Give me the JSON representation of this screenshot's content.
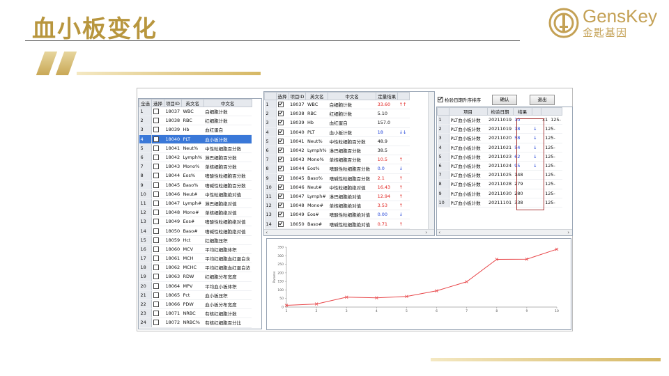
{
  "slide": {
    "title": "血小板变化",
    "logo_en": "GensKey",
    "logo_cn": "金匙基因"
  },
  "left_table": {
    "headers": [
      "全选",
      "选择",
      "项目ID",
      "英文名",
      "中文名"
    ],
    "rows": [
      {
        "n": "1",
        "id": "18037",
        "en": "WBC",
        "cn": "白细胞计数",
        "checked": false
      },
      {
        "n": "2",
        "id": "18038",
        "en": "RBC",
        "cn": "红细胞计数",
        "checked": false
      },
      {
        "n": "3",
        "id": "18039",
        "en": "Hb",
        "cn": "血红蛋白",
        "checked": false
      },
      {
        "n": "4",
        "id": "18040",
        "en": "PLT",
        "cn": "血小板计数",
        "checked": false,
        "selected": true
      },
      {
        "n": "5",
        "id": "18041",
        "en": "Neut%",
        "cn": "中性粒细胞百分数",
        "checked": false
      },
      {
        "n": "6",
        "id": "18042",
        "en": "Lymph%",
        "cn": "淋巴细胞百分数",
        "checked": false
      },
      {
        "n": "7",
        "id": "18043",
        "en": "Mono%",
        "cn": "单核细胞百分数",
        "checked": false
      },
      {
        "n": "8",
        "id": "18044",
        "en": "Eos%",
        "cn": "嗜酸性粒细胞百分数",
        "checked": false
      },
      {
        "n": "9",
        "id": "18045",
        "en": "Baso%",
        "cn": "嗜碱性粒细胞百分数",
        "checked": false
      },
      {
        "n": "10",
        "id": "18046",
        "en": "Neut#",
        "cn": "中性粒细胞绝对值",
        "checked": false
      },
      {
        "n": "11",
        "id": "18047",
        "en": "Lymph#",
        "cn": "淋巴细胞绝对值",
        "checked": false
      },
      {
        "n": "12",
        "id": "18048",
        "en": "Mono#",
        "cn": "单核细胞绝对值",
        "checked": false
      },
      {
        "n": "13",
        "id": "18049",
        "en": "Eos#",
        "cn": "嗜酸性粒细胞绝对值",
        "checked": false
      },
      {
        "n": "14",
        "id": "18050",
        "en": "Baso#",
        "cn": "嗜碱性粒细胞绝对值",
        "checked": false
      },
      {
        "n": "15",
        "id": "18059",
        "en": "Hct",
        "cn": "红细胞压积",
        "checked": false
      },
      {
        "n": "16",
        "id": "18060",
        "en": "MCV",
        "cn": "平均红细胞体积",
        "checked": false
      },
      {
        "n": "17",
        "id": "18061",
        "en": "MCH",
        "cn": "平均红细胞血红蛋白含",
        "checked": false
      },
      {
        "n": "18",
        "id": "18062",
        "en": "MCHC",
        "cn": "平均红细胞血红蛋白浓",
        "checked": false
      },
      {
        "n": "19",
        "id": "18063",
        "en": "RDW",
        "cn": "红细胞分布宽度",
        "checked": false
      },
      {
        "n": "20",
        "id": "18064",
        "en": "MPV",
        "cn": "平均血小板体积",
        "checked": false
      },
      {
        "n": "21",
        "id": "18065",
        "en": "Pct",
        "cn": "血小板压积",
        "checked": false
      },
      {
        "n": "22",
        "id": "18066",
        "en": "PDW",
        "cn": "血小板分布宽度",
        "checked": false
      },
      {
        "n": "23",
        "id": "18071",
        "en": "NRBC",
        "cn": "有核红细胞计数",
        "checked": false
      },
      {
        "n": "24",
        "id": "18072",
        "en": "NRBC%",
        "cn": "有核红细胞百分比",
        "checked": false
      }
    ]
  },
  "mid_table": {
    "headers": [
      "选择",
      "项目ID",
      "英文名",
      "中文名",
      "定量结果",
      ""
    ],
    "rows": [
      {
        "n": "1",
        "id": "18037",
        "en": "WBC",
        "cn": "白细胞计数",
        "val": "33.60",
        "flag": "↑↑",
        "color": "red"
      },
      {
        "n": "2",
        "id": "18038",
        "en": "RBC",
        "cn": "红细胞计数",
        "val": "5.10",
        "flag": "",
        "color": ""
      },
      {
        "n": "3",
        "id": "18039",
        "en": "Hb",
        "cn": "血红蛋白",
        "val": "157.0",
        "flag": "",
        "color": ""
      },
      {
        "n": "4",
        "id": "18040",
        "en": "PLT",
        "cn": "血小板计数",
        "val": "18",
        "flag": "↓↓",
        "color": "blue"
      },
      {
        "n": "5",
        "id": "18041",
        "en": "Neut%",
        "cn": "中性粒细胞百分数",
        "val": "48.9",
        "flag": "",
        "color": ""
      },
      {
        "n": "6",
        "id": "18042",
        "en": "Lymph%",
        "cn": "淋巴细胞百分数",
        "val": "38.5",
        "flag": "",
        "color": ""
      },
      {
        "n": "7",
        "id": "18043",
        "en": "Mono%",
        "cn": "单核细胞百分数",
        "val": "10.5",
        "flag": "↑",
        "color": "red"
      },
      {
        "n": "8",
        "id": "18044",
        "en": "Eos%",
        "cn": "嗜酸性粒细胞百分数",
        "val": "0.0",
        "flag": "↓",
        "color": "blue"
      },
      {
        "n": "9",
        "id": "18045",
        "en": "Baso%",
        "cn": "嗜碱性粒细胞百分数",
        "val": "2.1",
        "flag": "↑",
        "color": "red"
      },
      {
        "n": "10",
        "id": "18046",
        "en": "Neut#",
        "cn": "中性粒细胞绝对值",
        "val": "16.43",
        "flag": "↑",
        "color": "red"
      },
      {
        "n": "11",
        "id": "18047",
        "en": "Lymph#",
        "cn": "淋巴细胞绝对值",
        "val": "12.94",
        "flag": "↑",
        "color": "red"
      },
      {
        "n": "12",
        "id": "18048",
        "en": "Mono#",
        "cn": "单核细胞绝对值",
        "val": "3.53",
        "flag": "↑",
        "color": "red"
      },
      {
        "n": "13",
        "id": "18049",
        "en": "Eos#",
        "cn": "嗜酸性粒细胞绝对值",
        "val": "0.00",
        "flag": "↓",
        "color": "blue"
      },
      {
        "n": "14",
        "id": "18050",
        "en": "Baso#",
        "cn": "嗜碱性粒细胞绝对值",
        "val": "0.71",
        "flag": "↑",
        "color": "red"
      }
    ]
  },
  "right_panel": {
    "sort_label": "检验日期升序排序",
    "confirm_label": "确认",
    "exit_label": "退出",
    "headers": [
      "",
      "项目",
      "检验日期",
      "结果",
      "",
      ""
    ],
    "rows": [
      {
        "n": "1",
        "item": "PLT血小板计数",
        "date": "20211019",
        "val": "10",
        "flag": "",
        "color": "blue",
        "unit": "x1",
        "ref": "125-"
      },
      {
        "n": "2",
        "item": "PLT血小板计数",
        "date": "20211019",
        "val": "18",
        "flag": "↓",
        "color": "blue",
        "unit": "",
        "ref": "125-"
      },
      {
        "n": "3",
        "item": "PLT血小板计数",
        "date": "20211020",
        "val": "58",
        "flag": "↓",
        "color": "blue",
        "unit": "",
        "ref": "125-"
      },
      {
        "n": "4",
        "item": "PLT血小板计数",
        "date": "20211021",
        "val": "54",
        "flag": "↓",
        "color": "blue",
        "unit": "",
        "ref": "125-"
      },
      {
        "n": "5",
        "item": "PLT血小板计数",
        "date": "20211023",
        "val": "62",
        "flag": "↓",
        "color": "blue",
        "unit": "",
        "ref": "125-"
      },
      {
        "n": "6",
        "item": "PLT血小板计数",
        "date": "20211024",
        "val": "95",
        "flag": "↓",
        "color": "blue",
        "unit": "",
        "ref": "125-"
      },
      {
        "n": "7",
        "item": "PLT血小板计数",
        "date": "20211025",
        "val": "148",
        "flag": "",
        "color": "",
        "unit": "",
        "ref": "125-"
      },
      {
        "n": "8",
        "item": "PLT血小板计数",
        "date": "20211028",
        "val": "279",
        "flag": "",
        "color": "",
        "unit": "",
        "ref": "125-"
      },
      {
        "n": "9",
        "item": "PLT血小板计数",
        "date": "20211030",
        "val": "280",
        "flag": "",
        "color": "",
        "unit": "",
        "ref": "125-"
      },
      {
        "n": "10",
        "item": "PLT血小板计数",
        "date": "20211101",
        "val": "338",
        "flag": "",
        "color": "",
        "unit": "",
        "ref": "125-"
      }
    ]
  },
  "chart_data": {
    "type": "line",
    "x": [
      1,
      2,
      3,
      4,
      5,
      6,
      7,
      8,
      9,
      10
    ],
    "values": [
      10,
      18,
      58,
      54,
      62,
      95,
      148,
      279,
      280,
      338
    ],
    "ylabel": "Params",
    "ylim": [
      0,
      350
    ],
    "yticks": [
      0,
      50,
      100,
      150,
      200,
      250,
      300,
      350
    ],
    "line_color": "#e8474a",
    "grid": false
  }
}
